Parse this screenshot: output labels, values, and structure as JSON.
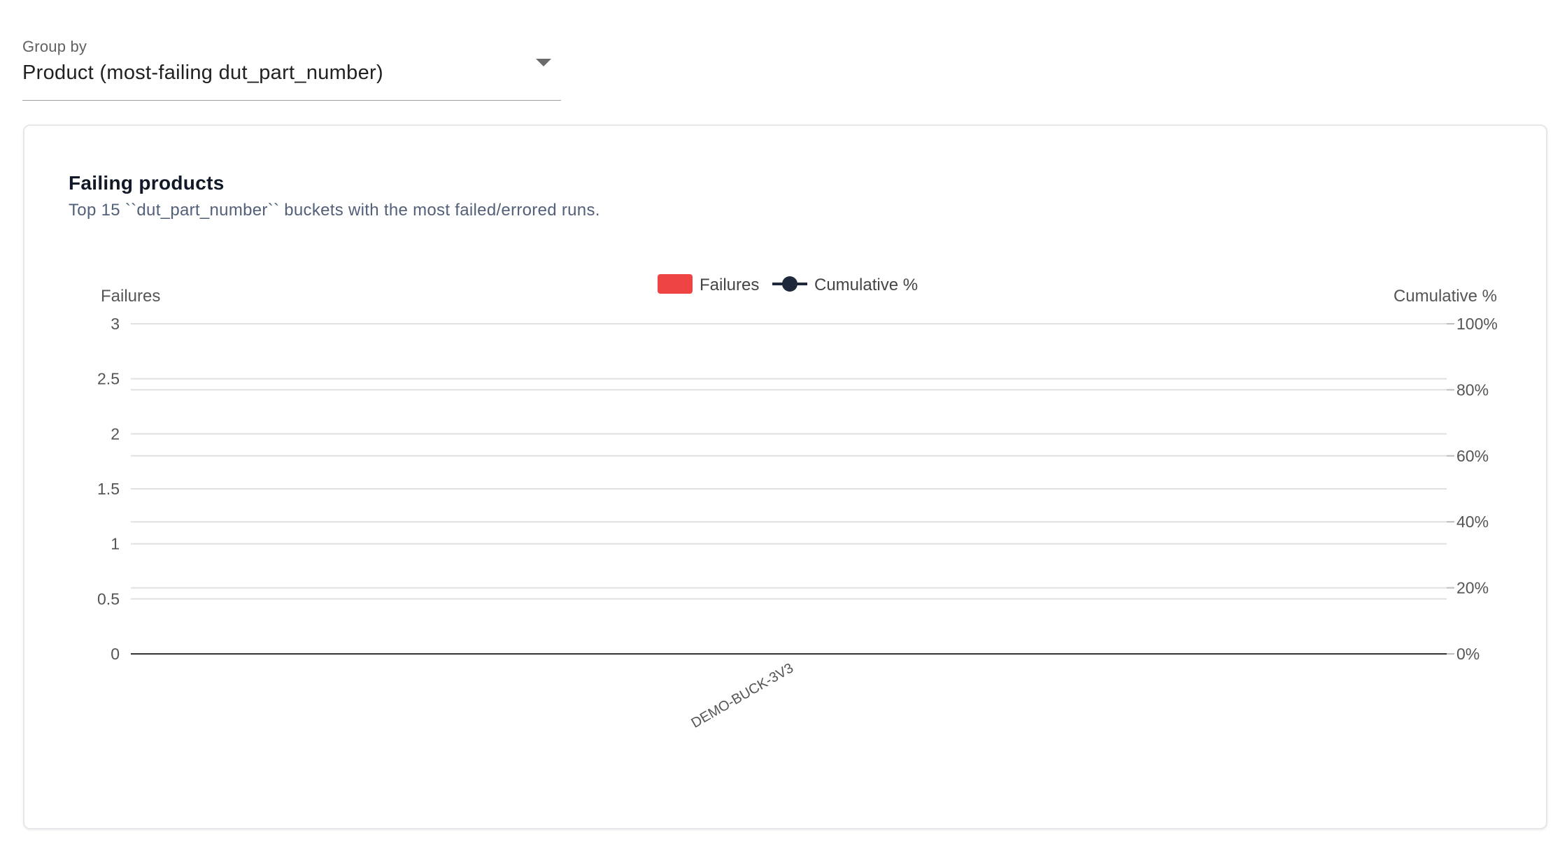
{
  "group_by": {
    "label": "Group by",
    "value": "Product (most-failing dut_part_number)"
  },
  "card": {
    "title": "Failing products",
    "subtitle": "Top 15 ``dut_part_number`` buckets with the most failed/errored runs."
  },
  "chart_data": {
    "type": "bar",
    "categories": [
      "DEMO-BUCK-3V3"
    ],
    "series": [
      {
        "name": "Failures",
        "type": "bar",
        "axis": "left",
        "values": [
          0
        ],
        "color": "#ef4444"
      },
      {
        "name": "Cumulative %",
        "type": "line",
        "axis": "right",
        "values": [
          0
        ],
        "color": "#1e293b"
      }
    ],
    "ylabel": "Failures",
    "y2label": "Cumulative %",
    "ylim": [
      0,
      3
    ],
    "y2lim": [
      0,
      100
    ],
    "y_ticks": [
      "0",
      "0.5",
      "1",
      "1.5",
      "2",
      "2.5",
      "3"
    ],
    "y2_ticks": [
      "0%",
      "20%",
      "40%",
      "60%",
      "80%",
      "100%"
    ],
    "legend_position": "top",
    "grid": true
  }
}
